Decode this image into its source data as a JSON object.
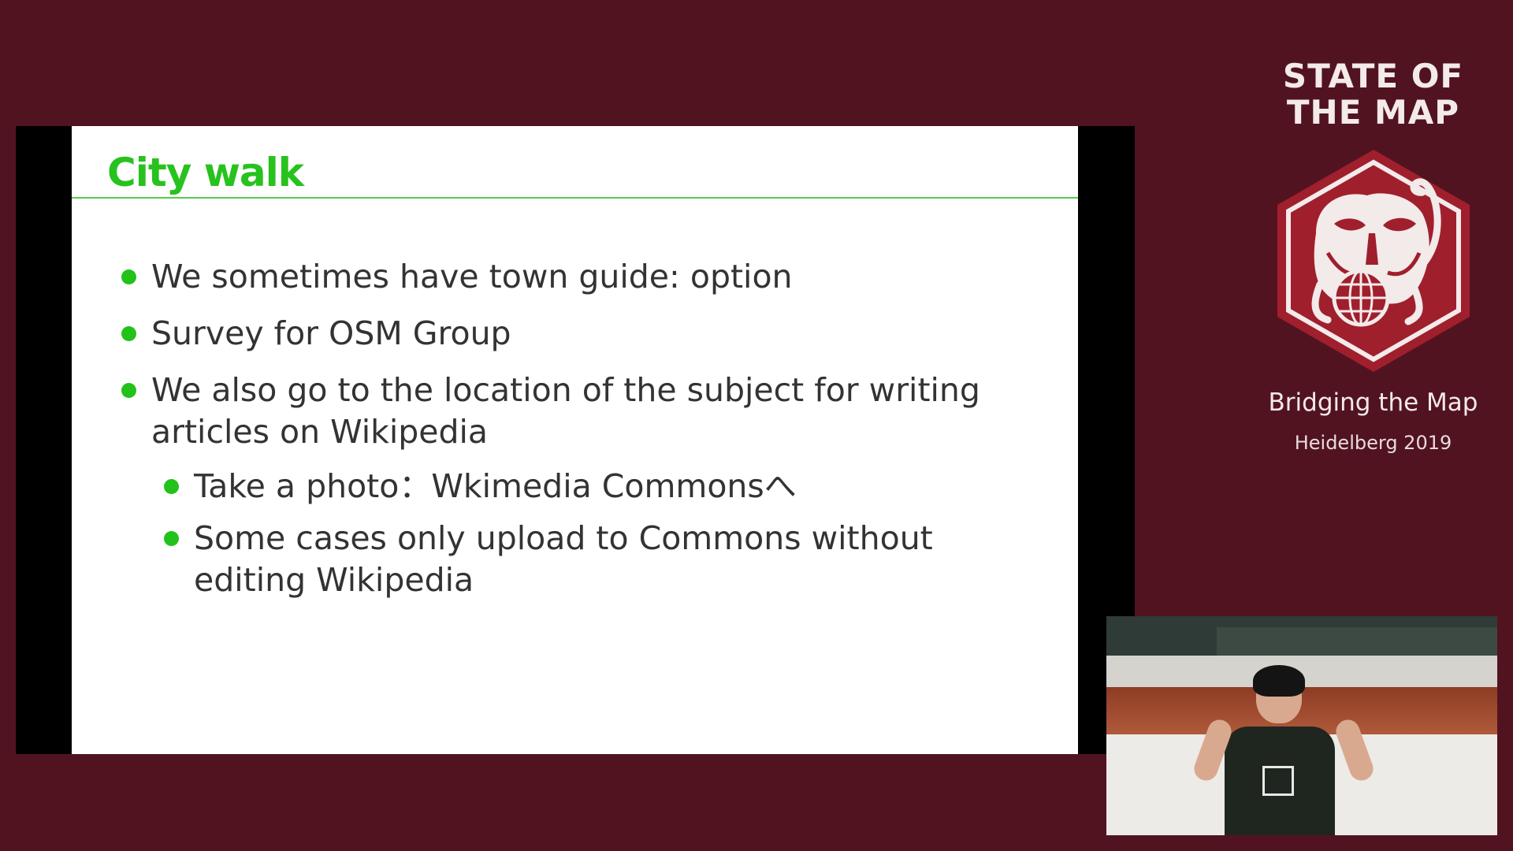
{
  "slide": {
    "title": "City walk",
    "bullets": [
      {
        "level": 1,
        "text": "We sometimes have town guide: option"
      },
      {
        "level": 1,
        "text": "Survey for OSM Group"
      },
      {
        "level": 1,
        "text": "We also go to the location of the subject for writing articles on Wikipedia"
      },
      {
        "level": 2,
        "text": "Take a photo：Wkimedia Commonsへ"
      },
      {
        "level": 2,
        "text": "Some cases only upload to Commons without editing Wikipedia"
      }
    ]
  },
  "branding": {
    "title_line1": "STATE OF",
    "title_line2": "THE MAP",
    "subtitle": "Bridging the Map",
    "event": "Heidelberg 2019"
  },
  "colors": {
    "background": "#521320",
    "accent_green": "#27c21e",
    "logo_red": "#a01f2d",
    "logo_cream": "#f3eaea"
  },
  "icons": {
    "logo": "state-of-the-map-hexagon-logo",
    "bullet": "green-dot"
  }
}
